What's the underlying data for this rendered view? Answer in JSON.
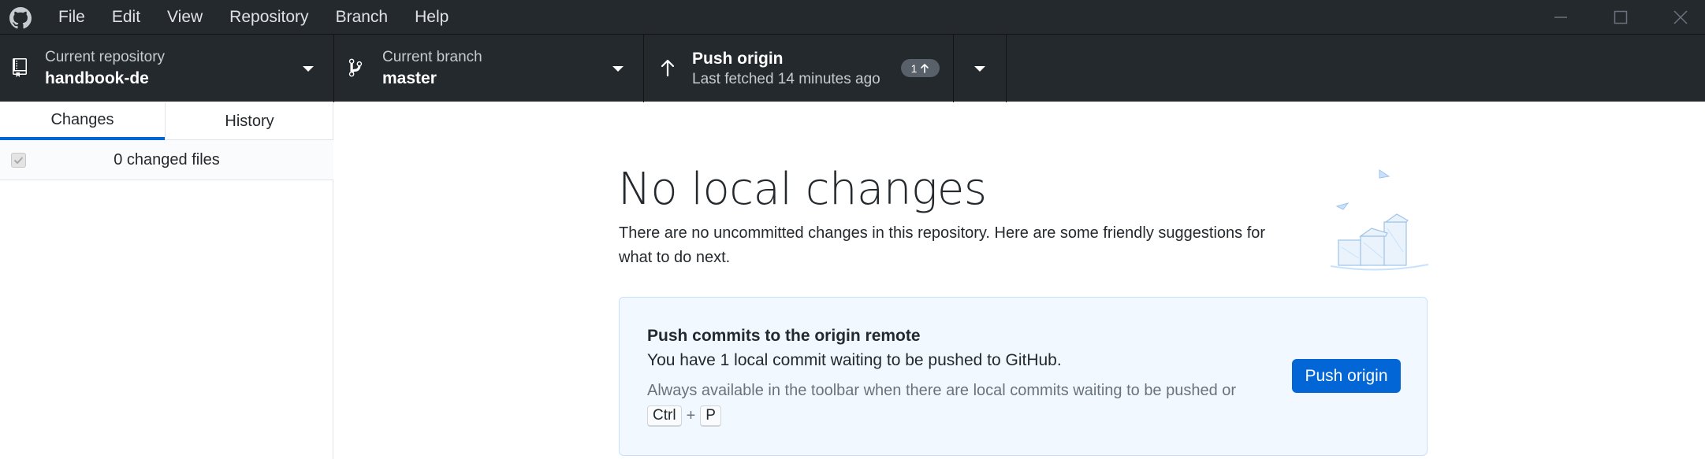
{
  "menu": {
    "items": [
      "File",
      "Edit",
      "View",
      "Repository",
      "Branch",
      "Help"
    ]
  },
  "toolbar": {
    "repository": {
      "label": "Current repository",
      "value": "handbook-de"
    },
    "branch": {
      "label": "Current branch",
      "value": "master"
    },
    "push": {
      "title": "Push origin",
      "subtitle": "Last fetched 14 minutes ago",
      "badge_count": "1"
    }
  },
  "sidebar": {
    "tabs": [
      "Changes",
      "History"
    ],
    "active_tab": "Changes",
    "changed_files": "0 changed files"
  },
  "main": {
    "title": "No local changes",
    "description": "There are no uncommitted changes in this repository. Here are some friendly suggestions for what to do next.",
    "card": {
      "title": "Push commits to the origin remote",
      "description": "You have 1 local commit waiting to be pushed to GitHub.",
      "hint": "Always available in the toolbar when there are local commits waiting to be pushed or",
      "shortcut": {
        "key1": "Ctrl",
        "plus": "+",
        "key2": "P"
      },
      "button_label": "Push origin"
    }
  },
  "colors": {
    "titlebar_bg": "#24292e",
    "accent": "#0366d6",
    "card_bg": "#f1f8ff",
    "card_border": "#c8e1ff"
  },
  "icons": [
    "github-logo-icon",
    "repo-icon",
    "branch-icon",
    "arrow-up-icon",
    "caret-down-icon",
    "minimize-icon",
    "maximize-icon",
    "close-icon"
  ]
}
